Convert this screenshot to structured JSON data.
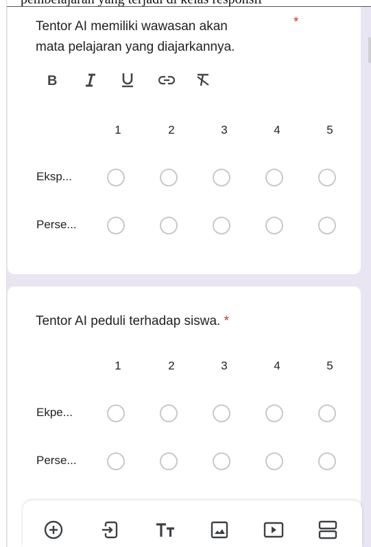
{
  "top_cut_text": "pembelajaran yang terjadi di kelas responsif",
  "question1": {
    "title_line1": "Tentor AI memiliki wawasan akan",
    "title_line2": "mata pelajaran yang diajarkannya.",
    "required_mark": "*",
    "format_tools": [
      "bold-icon",
      "italic-icon",
      "underline-icon",
      "link-icon",
      "clear-format-icon"
    ],
    "columns": [
      "1",
      "2",
      "3",
      "4",
      "5"
    ],
    "rows": [
      "Eksp...",
      "Perse..."
    ]
  },
  "question2": {
    "title": "Tentor AI peduli terhadap siswa.",
    "required_mark": "*",
    "columns": [
      "1",
      "2",
      "3",
      "4",
      "5"
    ],
    "rows": [
      "Ekpe...",
      "Perse..."
    ]
  },
  "bottom_toolbar": [
    "add-question-icon",
    "import-questions-icon",
    "add-title-icon",
    "add-image-icon",
    "add-video-icon",
    "add-section-icon"
  ],
  "colors": {
    "background": "#e9e5f2",
    "card": "#ffffff",
    "required": "#d93025",
    "radio_border": "#c8c8cc"
  }
}
